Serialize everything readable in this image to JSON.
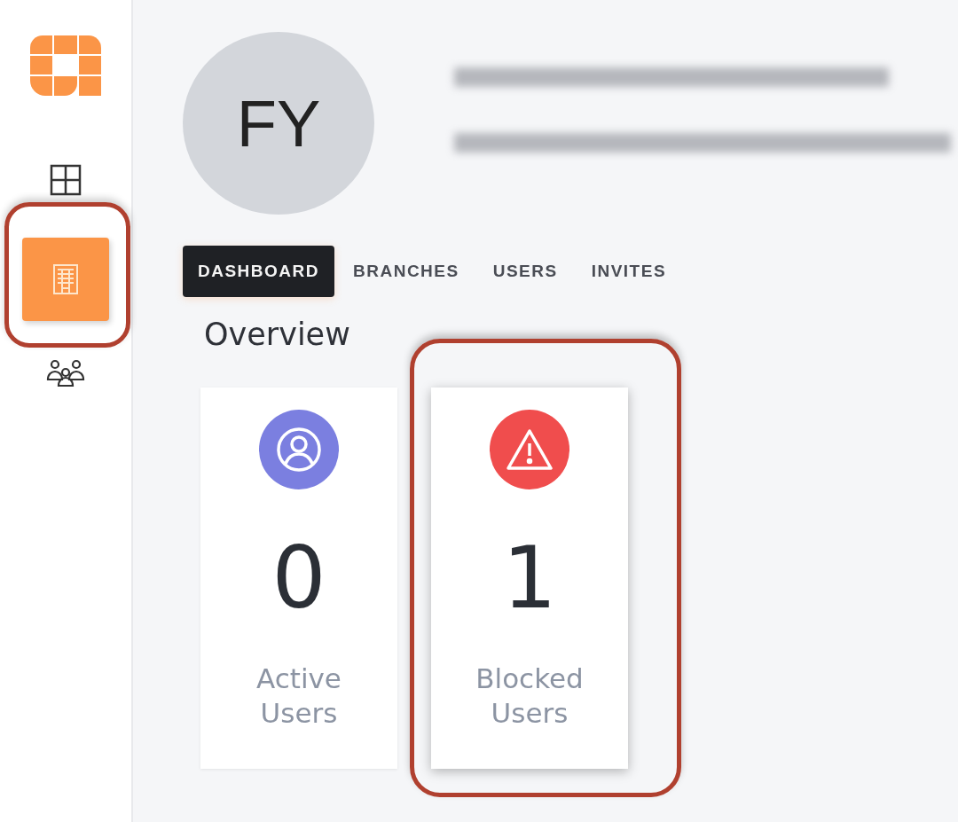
{
  "sidebar": {
    "items": [
      {
        "kind": "grid",
        "selected": false,
        "highlighted": false
      },
      {
        "kind": "building",
        "selected": true,
        "highlighted": true
      },
      {
        "kind": "people",
        "selected": false,
        "highlighted": false
      }
    ]
  },
  "profile": {
    "initials": "FY"
  },
  "tabs": [
    {
      "label": "DASHBOARD",
      "selected": true
    },
    {
      "label": "BRANCHES",
      "selected": false
    },
    {
      "label": "USERS",
      "selected": false
    },
    {
      "label": "INVITES",
      "selected": false
    }
  ],
  "overview": {
    "title": "Overview",
    "cards": [
      {
        "kind": "user",
        "color": "#7b7fe0",
        "count": "0",
        "label": "Active Users",
        "highlighted": false
      },
      {
        "kind": "warning",
        "color": "#f04d4d",
        "count": "1",
        "label": "Blocked Users",
        "highlighted": true
      }
    ]
  }
}
